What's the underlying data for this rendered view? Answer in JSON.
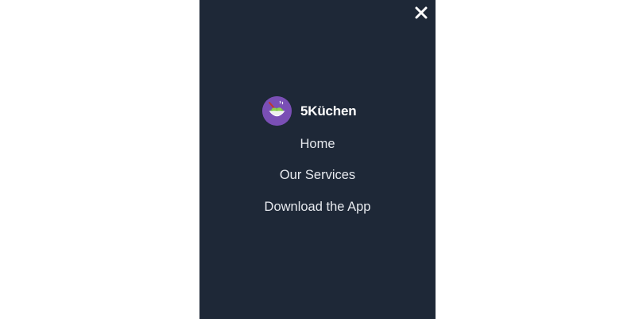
{
  "menu": {
    "brand": {
      "name": "5Küchen",
      "logo_icon": "salad-bowl-icon",
      "logo_bg": "#7a4fb5"
    },
    "close_icon": "close-icon",
    "items": [
      {
        "label": "Home"
      },
      {
        "label": "Our Services"
      },
      {
        "label": "Download the App"
      }
    ],
    "panel_color": "#1e2837",
    "text_color": "#e6e9ee"
  }
}
